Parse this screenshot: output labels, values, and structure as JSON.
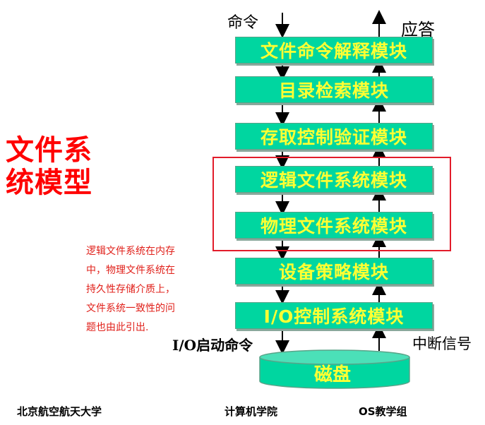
{
  "title": {
    "line1": "文件系",
    "line2": "统模型"
  },
  "top_labels": {
    "command": "命令",
    "response": "应答"
  },
  "modules": [
    "文件命令解释模块",
    "目录检索模块",
    "存取控制验证模块",
    "逻辑文件系统模块",
    "物理文件系统模块",
    "设备策略模块",
    "I/O控制系统模块"
  ],
  "bottom_labels": {
    "io_start": "I/O启动命令",
    "interrupt": "中断信号"
  },
  "disk": {
    "label": "磁盘"
  },
  "note": {
    "lines": [
      "逻辑文件系统在内存",
      "中，物理文件系统在",
      "持久性存储介质上，",
      "文件系统一致性的问",
      "题也由此引出."
    ]
  },
  "footer": {
    "left": "北京航空航天大学",
    "center": "计算机学院",
    "right": "OS教学组"
  },
  "colors": {
    "module_fill": "#00d6a0",
    "module_text": "#ffff33",
    "title_red": "#ff0000",
    "box_red": "#e21c2a"
  }
}
